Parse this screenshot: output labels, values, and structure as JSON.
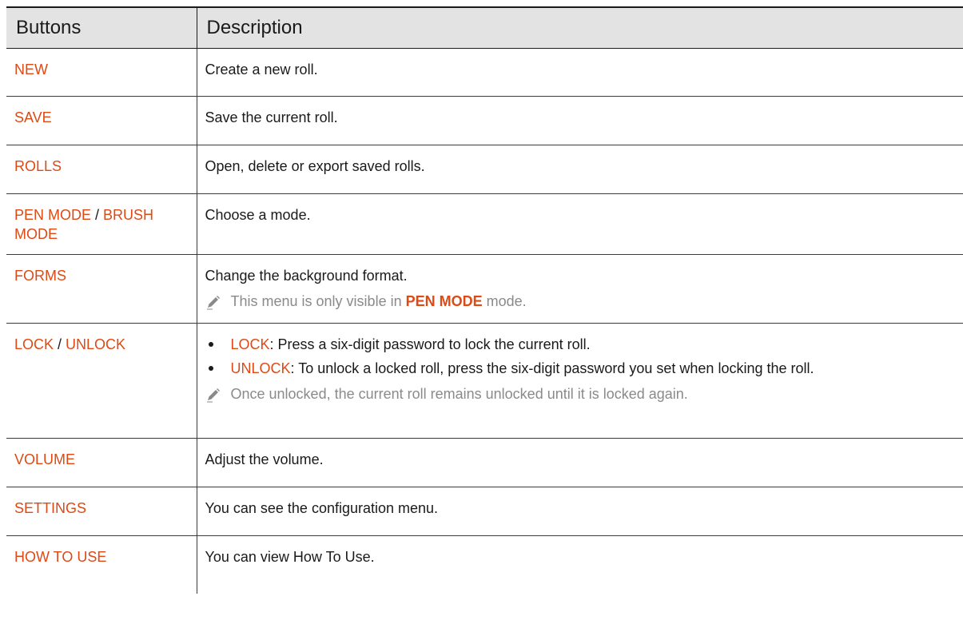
{
  "table": {
    "headers": [
      "Buttons",
      "Description"
    ],
    "rows": [
      {
        "button": "NEW",
        "description": "Create a new roll."
      },
      {
        "button": "SAVE",
        "description": "Save the current roll."
      },
      {
        "button": "ROLLS",
        "description": "Open, delete or export saved rolls."
      },
      {
        "button_a": "PEN MODE",
        "separator": " / ",
        "button_b": "BRUSH MODE",
        "description": "Choose a mode."
      },
      {
        "button": "FORMS",
        "description": "Change the background format.",
        "note": {
          "text_before": "This menu is only visible in ",
          "keyword": "PEN MODE",
          "text_after": " mode."
        }
      },
      {
        "button_a": "LOCK",
        "separator": " / ",
        "button_b": "UNLOCK",
        "bullets": [
          {
            "keyword": "LOCK",
            "text": ": Press a six-digit password to lock the current roll."
          },
          {
            "keyword": "UNLOCK",
            "text": ": To unlock a locked roll, press the six-digit password you set when locking the roll."
          }
        ],
        "note": "Once unlocked, the current roll remains unlocked until it is locked again."
      },
      {
        "button": "VOLUME",
        "description": "Adjust the volume."
      },
      {
        "button": "SETTINGS",
        "description": "You can see the configuration menu."
      },
      {
        "button": "HOW TO USE",
        "description": "You can view How To Use."
      }
    ]
  },
  "colors": {
    "accent": "#dd4a15",
    "header_bg": "#e3e3e3",
    "note_text": "#8a8a8a",
    "text": "#1a1a1a"
  },
  "icons": {
    "note": "pencil-icon"
  }
}
